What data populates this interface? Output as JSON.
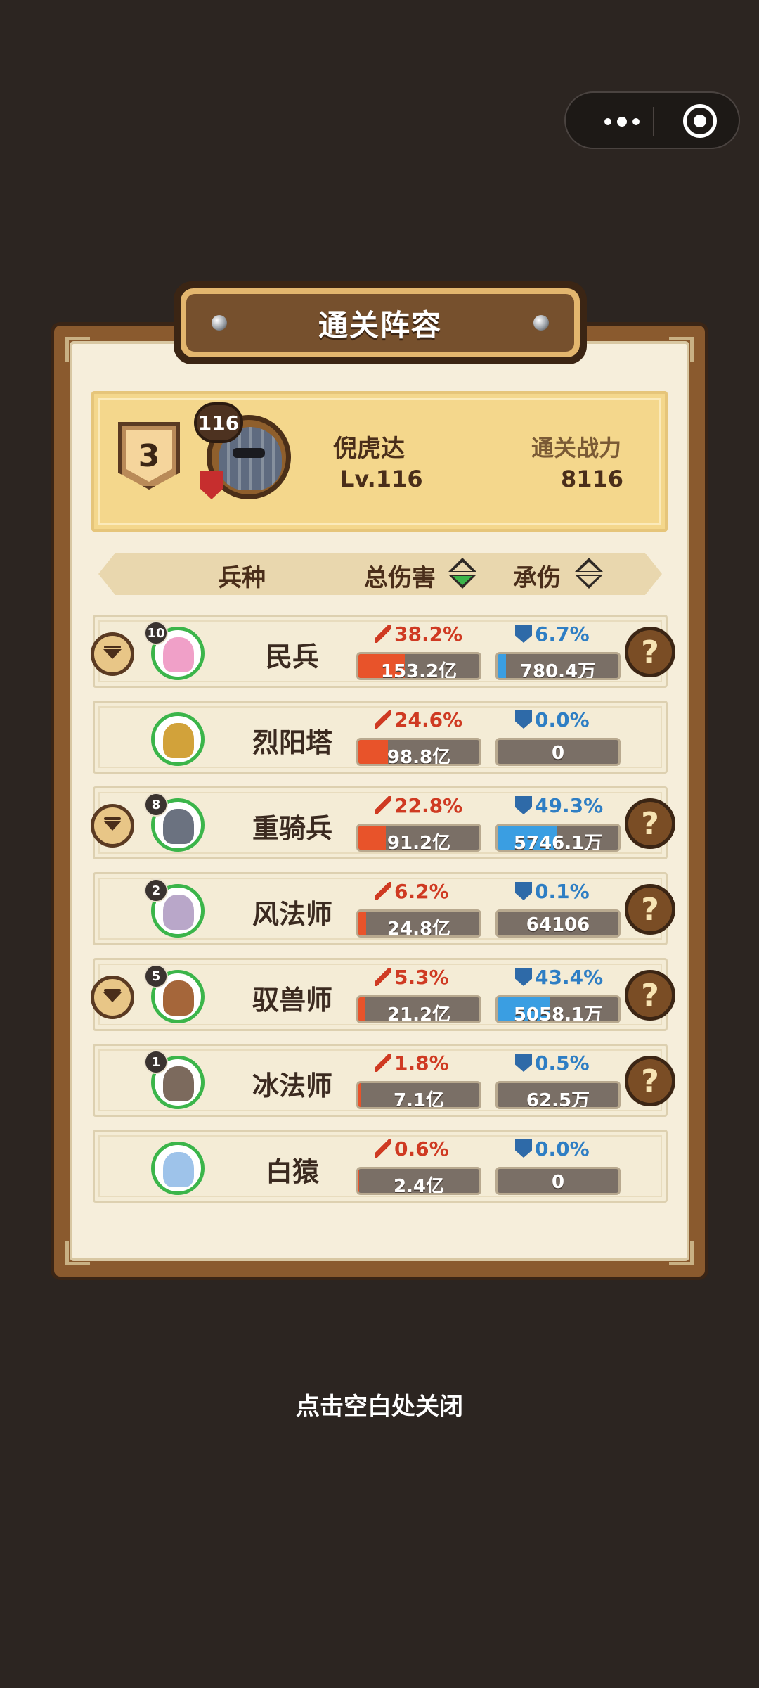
{
  "capsule": {
    "more_icon": "more-dots-icon",
    "close_icon": "target-icon"
  },
  "panel": {
    "title": "通关阵容"
  },
  "leader": {
    "rank": "3",
    "level_badge": "116",
    "name": "倪虎达",
    "level_text": "Lv.116",
    "power_label": "通关战力",
    "power_value": "8116"
  },
  "columns": {
    "unit": "兵种",
    "damage": "总伤害",
    "taken": "承伤"
  },
  "units": [
    {
      "name": "民兵",
      "count": "10",
      "dmg_pct": "38.2%",
      "dmg_val": "153.2亿",
      "dmg_fill": 0.382,
      "tank_pct": "6.7%",
      "tank_val": "780.4万",
      "tank_fill": 0.067,
      "expand": true,
      "help": true,
      "color": "#f0a0c8"
    },
    {
      "name": "烈阳塔",
      "count": "",
      "dmg_pct": "24.6%",
      "dmg_val": "98.8亿",
      "dmg_fill": 0.246,
      "tank_pct": "0.0%",
      "tank_val": "0",
      "tank_fill": 0,
      "expand": false,
      "help": false,
      "color": "#d2a23a"
    },
    {
      "name": "重骑兵",
      "count": "8",
      "dmg_pct": "22.8%",
      "dmg_val": "91.2亿",
      "dmg_fill": 0.228,
      "tank_pct": "49.3%",
      "tank_val": "5746.1万",
      "tank_fill": 0.493,
      "expand": true,
      "help": true,
      "color": "#6b7280"
    },
    {
      "name": "风法师",
      "count": "2",
      "dmg_pct": "6.2%",
      "dmg_val": "24.8亿",
      "dmg_fill": 0.062,
      "tank_pct": "0.1%",
      "tank_val": "64106",
      "tank_fill": 0.001,
      "expand": false,
      "help": true,
      "color": "#b9a7c9"
    },
    {
      "name": "驭兽师",
      "count": "5",
      "dmg_pct": "5.3%",
      "dmg_val": "21.2亿",
      "dmg_fill": 0.053,
      "tank_pct": "43.4%",
      "tank_val": "5058.1万",
      "tank_fill": 0.434,
      "expand": true,
      "help": true,
      "color": "#a5663a"
    },
    {
      "name": "冰法师",
      "count": "1",
      "dmg_pct": "1.8%",
      "dmg_val": "7.1亿",
      "dmg_fill": 0.018,
      "tank_pct": "0.5%",
      "tank_val": "62.5万",
      "tank_fill": 0.005,
      "expand": false,
      "help": true,
      "color": "#7c6a5d"
    },
    {
      "name": "白猿",
      "count": "",
      "dmg_pct": "0.6%",
      "dmg_val": "2.4亿",
      "dmg_fill": 0.006,
      "tank_pct": "0.0%",
      "tank_val": "0",
      "tank_fill": 0,
      "expand": false,
      "help": false,
      "color": "#9ec3ea"
    }
  ],
  "close_hint": "点击空白处关闭"
}
